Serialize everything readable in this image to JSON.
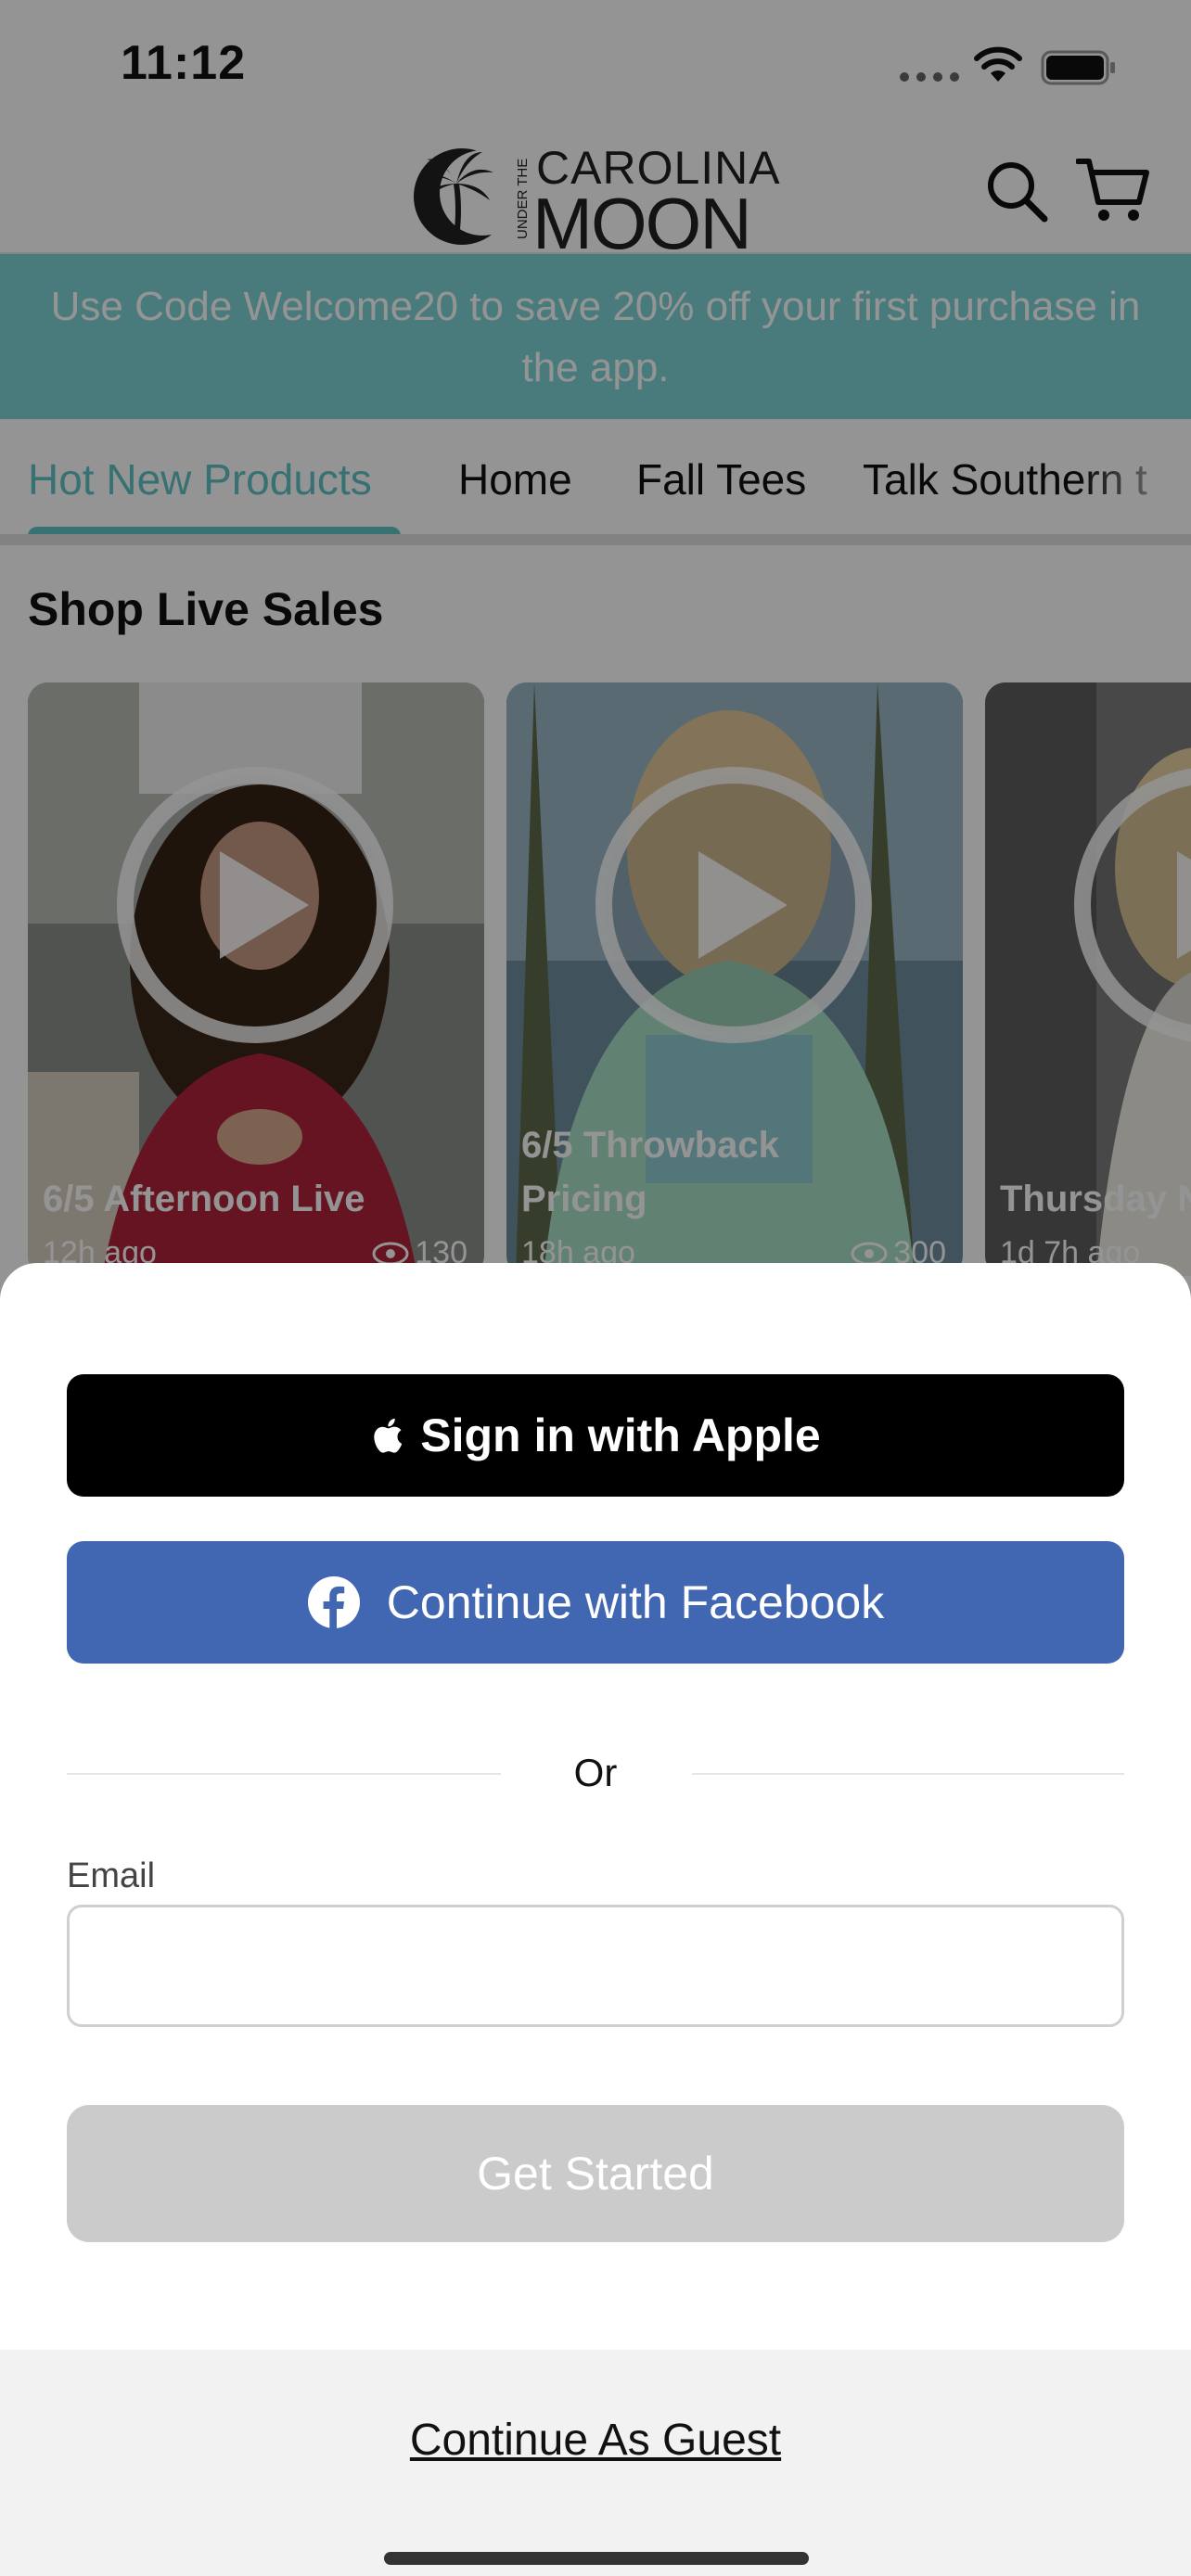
{
  "status_bar": {
    "time": "11:12"
  },
  "header": {
    "logo_top_small": "UNDER THE",
    "logo_line1": "CAROLINA",
    "logo_line2": "MOON",
    "search_icon": "search-icon",
    "cart_icon": "cart-icon"
  },
  "promo": {
    "text": "Use Code Welcome20 to save 20% off your first purchase in the app."
  },
  "tabs": [
    {
      "label": "Hot New Products",
      "active": true
    },
    {
      "label": "Home",
      "active": false
    },
    {
      "label": "Fall Tees",
      "active": false
    },
    {
      "label": "Talk Southern t",
      "active": false
    }
  ],
  "live_section": {
    "title": "Shop Live Sales",
    "cards": [
      {
        "title": "6/5 Afternoon Live",
        "meta": "12h ago",
        "views": "130"
      },
      {
        "title": "6/5 Throwback Pricing",
        "meta": "18h ago",
        "views": "300"
      },
      {
        "title": "Thursday N",
        "meta": "1d 7h ago",
        "views": ""
      }
    ]
  },
  "sheet": {
    "apple_label": "Sign in with Apple",
    "facebook_label": "Continue with Facebook",
    "or_text": "Or",
    "email_label": "Email",
    "email_value": "",
    "email_placeholder": "",
    "get_started_label": "Get Started",
    "guest_label": "Continue As Guest"
  },
  "colors": {
    "accent_teal": "#5fc3c4",
    "promo_bg": "#7fd5d6",
    "facebook_blue": "#4267b2",
    "apple_black": "#000000",
    "disabled_gray": "#cbcbcb"
  }
}
